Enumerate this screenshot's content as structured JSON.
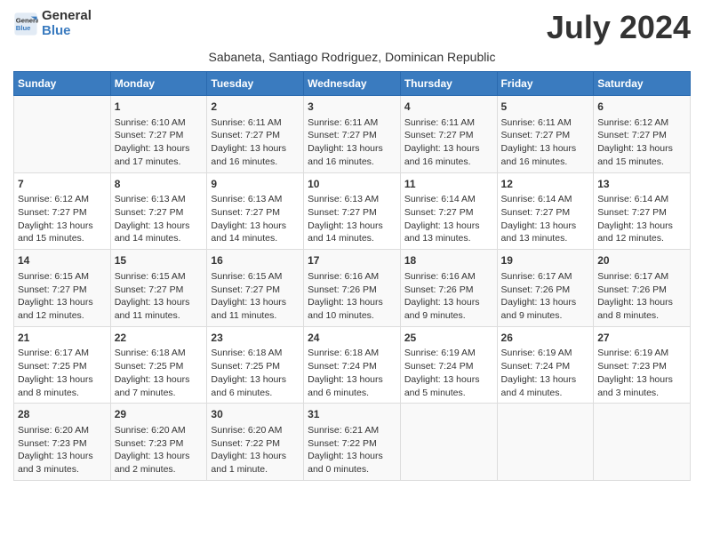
{
  "header": {
    "logo_line1": "General",
    "logo_line2": "Blue",
    "month_title": "July 2024",
    "subtitle": "Sabaneta, Santiago Rodriguez, Dominican Republic"
  },
  "columns": [
    "Sunday",
    "Monday",
    "Tuesday",
    "Wednesday",
    "Thursday",
    "Friday",
    "Saturday"
  ],
  "weeks": [
    [
      {
        "day": "",
        "info": ""
      },
      {
        "day": "1",
        "info": "Sunrise: 6:10 AM\nSunset: 7:27 PM\nDaylight: 13 hours\nand 17 minutes."
      },
      {
        "day": "2",
        "info": "Sunrise: 6:11 AM\nSunset: 7:27 PM\nDaylight: 13 hours\nand 16 minutes."
      },
      {
        "day": "3",
        "info": "Sunrise: 6:11 AM\nSunset: 7:27 PM\nDaylight: 13 hours\nand 16 minutes."
      },
      {
        "day": "4",
        "info": "Sunrise: 6:11 AM\nSunset: 7:27 PM\nDaylight: 13 hours\nand 16 minutes."
      },
      {
        "day": "5",
        "info": "Sunrise: 6:11 AM\nSunset: 7:27 PM\nDaylight: 13 hours\nand 16 minutes."
      },
      {
        "day": "6",
        "info": "Sunrise: 6:12 AM\nSunset: 7:27 PM\nDaylight: 13 hours\nand 15 minutes."
      }
    ],
    [
      {
        "day": "7",
        "info": "Sunrise: 6:12 AM\nSunset: 7:27 PM\nDaylight: 13 hours\nand 15 minutes."
      },
      {
        "day": "8",
        "info": "Sunrise: 6:13 AM\nSunset: 7:27 PM\nDaylight: 13 hours\nand 14 minutes."
      },
      {
        "day": "9",
        "info": "Sunrise: 6:13 AM\nSunset: 7:27 PM\nDaylight: 13 hours\nand 14 minutes."
      },
      {
        "day": "10",
        "info": "Sunrise: 6:13 AM\nSunset: 7:27 PM\nDaylight: 13 hours\nand 14 minutes."
      },
      {
        "day": "11",
        "info": "Sunrise: 6:14 AM\nSunset: 7:27 PM\nDaylight: 13 hours\nand 13 minutes."
      },
      {
        "day": "12",
        "info": "Sunrise: 6:14 AM\nSunset: 7:27 PM\nDaylight: 13 hours\nand 13 minutes."
      },
      {
        "day": "13",
        "info": "Sunrise: 6:14 AM\nSunset: 7:27 PM\nDaylight: 13 hours\nand 12 minutes."
      }
    ],
    [
      {
        "day": "14",
        "info": "Sunrise: 6:15 AM\nSunset: 7:27 PM\nDaylight: 13 hours\nand 12 minutes."
      },
      {
        "day": "15",
        "info": "Sunrise: 6:15 AM\nSunset: 7:27 PM\nDaylight: 13 hours\nand 11 minutes."
      },
      {
        "day": "16",
        "info": "Sunrise: 6:15 AM\nSunset: 7:27 PM\nDaylight: 13 hours\nand 11 minutes."
      },
      {
        "day": "17",
        "info": "Sunrise: 6:16 AM\nSunset: 7:26 PM\nDaylight: 13 hours\nand 10 minutes."
      },
      {
        "day": "18",
        "info": "Sunrise: 6:16 AM\nSunset: 7:26 PM\nDaylight: 13 hours\nand 9 minutes."
      },
      {
        "day": "19",
        "info": "Sunrise: 6:17 AM\nSunset: 7:26 PM\nDaylight: 13 hours\nand 9 minutes."
      },
      {
        "day": "20",
        "info": "Sunrise: 6:17 AM\nSunset: 7:26 PM\nDaylight: 13 hours\nand 8 minutes."
      }
    ],
    [
      {
        "day": "21",
        "info": "Sunrise: 6:17 AM\nSunset: 7:25 PM\nDaylight: 13 hours\nand 8 minutes."
      },
      {
        "day": "22",
        "info": "Sunrise: 6:18 AM\nSunset: 7:25 PM\nDaylight: 13 hours\nand 7 minutes."
      },
      {
        "day": "23",
        "info": "Sunrise: 6:18 AM\nSunset: 7:25 PM\nDaylight: 13 hours\nand 6 minutes."
      },
      {
        "day": "24",
        "info": "Sunrise: 6:18 AM\nSunset: 7:24 PM\nDaylight: 13 hours\nand 6 minutes."
      },
      {
        "day": "25",
        "info": "Sunrise: 6:19 AM\nSunset: 7:24 PM\nDaylight: 13 hours\nand 5 minutes."
      },
      {
        "day": "26",
        "info": "Sunrise: 6:19 AM\nSunset: 7:24 PM\nDaylight: 13 hours\nand 4 minutes."
      },
      {
        "day": "27",
        "info": "Sunrise: 6:19 AM\nSunset: 7:23 PM\nDaylight: 13 hours\nand 3 minutes."
      }
    ],
    [
      {
        "day": "28",
        "info": "Sunrise: 6:20 AM\nSunset: 7:23 PM\nDaylight: 13 hours\nand 3 minutes."
      },
      {
        "day": "29",
        "info": "Sunrise: 6:20 AM\nSunset: 7:23 PM\nDaylight: 13 hours\nand 2 minutes."
      },
      {
        "day": "30",
        "info": "Sunrise: 6:20 AM\nSunset: 7:22 PM\nDaylight: 13 hours\nand 1 minute."
      },
      {
        "day": "31",
        "info": "Sunrise: 6:21 AM\nSunset: 7:22 PM\nDaylight: 13 hours\nand 0 minutes."
      },
      {
        "day": "",
        "info": ""
      },
      {
        "day": "",
        "info": ""
      },
      {
        "day": "",
        "info": ""
      }
    ]
  ]
}
